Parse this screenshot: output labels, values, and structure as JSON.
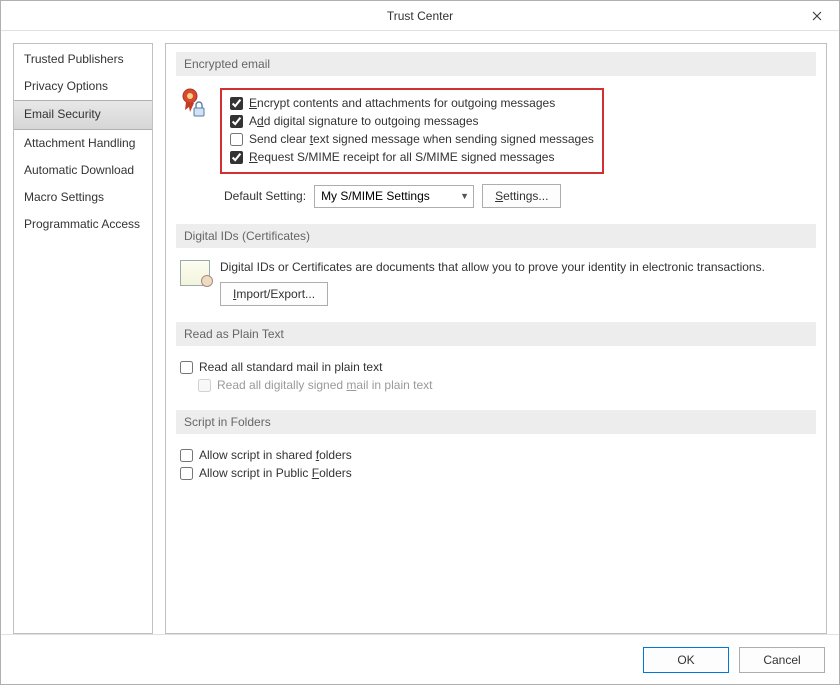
{
  "window": {
    "title": "Trust Center"
  },
  "sidebar": {
    "items": [
      {
        "label": "Trusted Publishers"
      },
      {
        "label": "Privacy Options"
      },
      {
        "label": "Email Security",
        "selected": true
      },
      {
        "label": "Attachment Handling"
      },
      {
        "label": "Automatic Download"
      },
      {
        "label": "Macro Settings"
      },
      {
        "label": "Programmatic Access"
      }
    ]
  },
  "sections": {
    "encrypted": {
      "header": "Encrypted email",
      "checks": [
        {
          "label_html": "<u>E</u>ncrypt contents and attachments for outgoing messages",
          "checked": true
        },
        {
          "label_html": "A<u>d</u>d digital signature to outgoing messages",
          "checked": true
        },
        {
          "label_html": "Send clear <u>t</u>ext signed message when sending signed messages",
          "checked": false
        },
        {
          "label_html": "<u>R</u>equest S/MIME receipt for all S/MIME signed messages",
          "checked": true
        }
      ],
      "default_label": "Default Setting:",
      "default_value": "My S/MIME Settings",
      "settings_btn_html": "<u>S</u>ettings..."
    },
    "digital": {
      "header": "Digital IDs (Certificates)",
      "text": "Digital IDs or Certificates are documents that allow you to prove your identity in electronic transactions.",
      "btn_html": "<u>I</u>mport/Export..."
    },
    "plain": {
      "header": "Read as Plain Text",
      "chk1_html": "Read all standard mail in plain text",
      "chk2_html": "Read all digitally signed <u>m</u>ail in plain text"
    },
    "script": {
      "header": "Script in Folders",
      "chk1_html": "Allow script in shared <u>f</u>olders",
      "chk2_html": "Allow script in Public <u>F</u>olders"
    }
  },
  "footer": {
    "ok": "OK",
    "cancel": "Cancel"
  }
}
